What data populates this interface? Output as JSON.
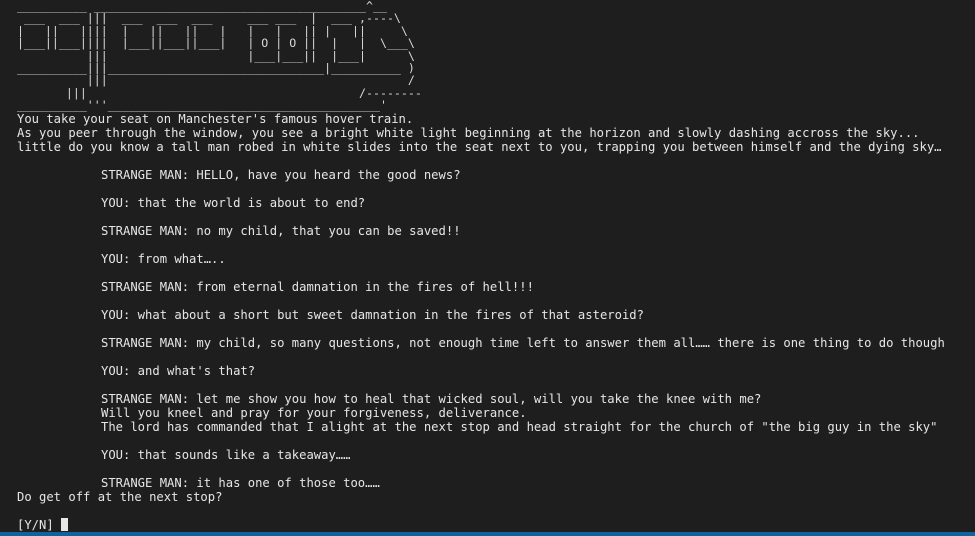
{
  "ascii_art": [
    "__________ _______________________________________^__",
    " ___  ___ |||  ___  ___  ___     ___ ___  |  ___ ,----\\",
    "|   ||   ||||  |   ||   ||   |   |   |   || |   ||     \\",
    "|___||___||||  |___||___||___|   | O | O ||  |   |  \\___\\",
    "          |||                    |___|___||  |___|      \\",
    "__________|||_______________________________|__________ )",
    "          |||                                           /",
    "       |||                                       /--------",
    "__________'''_______________________________________'"
  ],
  "intro": [
    "You take your seat on Manchester's famous hover train.",
    "As you peer through the window, you see a bright white light beginning at the horizon and slowly dashing accross the sky...",
    "little do you know a tall man robed in white slides into the seat next to you, trapping you between himself and the dying sky…"
  ],
  "dialogue": [
    [
      "STRANGE MAN: HELLO, have you heard the good news?"
    ],
    [
      "YOU: that the world is about to end?"
    ],
    [
      "STRANGE MAN: no my child, that you can be saved!!"
    ],
    [
      "YOU: from what….."
    ],
    [
      "STRANGE MAN: from eternal damnation in the fires of hell!!!"
    ],
    [
      "YOU: what about a short but sweet damnation in the fires of that asteroid?"
    ],
    [
      "STRANGE MAN: my child, so many questions, not enough time left to answer them all…… there is one thing to do though"
    ],
    [
      "YOU: and what's that?"
    ],
    [
      "STRANGE MAN: let me show you how to heal that wicked soul, will you take the knee with me?",
      "Will you kneel and pray for your forgiveness, deliverance.",
      "The lord has commanded that I alight at the next stop and head straight for the church of \"the big guy in the sky\""
    ],
    [
      "YOU: that sounds like a takeaway……"
    ],
    [
      "STRANGE MAN: it has one of those too……"
    ]
  ],
  "question": "Do get off at the next stop?",
  "prompt": "[Y/N]"
}
